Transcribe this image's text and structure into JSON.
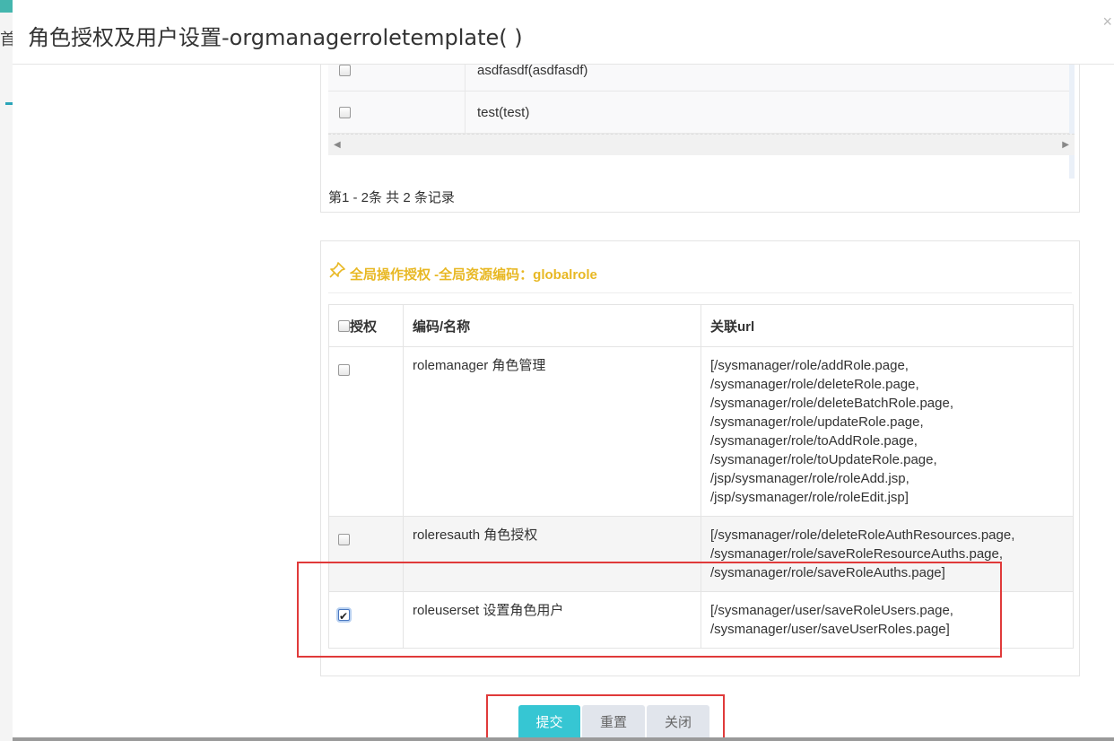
{
  "background": {
    "partial_char": "首"
  },
  "modal": {
    "title": "角色授权及用户设置-orgmanagerroletemplate( )",
    "close_label": "×"
  },
  "roles_panel": {
    "rows": [
      {
        "label": "asdfasdf(asdfasdf)",
        "checked": false
      },
      {
        "label": "test(test)",
        "checked": false
      }
    ],
    "pager_text": "第1 - 2条 共 2 条记录"
  },
  "auth_panel": {
    "icon": "pin-icon",
    "title": "全局操作授权 -全局资源编码：globalrole",
    "columns": {
      "auth": "授权",
      "code": "编码/名称",
      "url": "关联url"
    },
    "rows": [
      {
        "checked": false,
        "code_name": "rolemanager 角色管理",
        "urls": [
          "[/sysmanager/role/addRole.page,",
          "/sysmanager/role/deleteRole.page,",
          "/sysmanager/role/deleteBatchRole.page,",
          "/sysmanager/role/updateRole.page,",
          "/sysmanager/role/toAddRole.page,",
          "/sysmanager/role/toUpdateRole.page,",
          "/jsp/sysmanager/role/roleAdd.jsp,",
          "/jsp/sysmanager/role/roleEdit.jsp]"
        ]
      },
      {
        "checked": false,
        "code_name": "roleresauth 角色授权",
        "urls": [
          "[/sysmanager/role/deleteRoleAuthResources.page,",
          "/sysmanager/role/saveRoleResourceAuths.page,",
          "/sysmanager/role/saveRoleAuths.page]"
        ]
      },
      {
        "checked": true,
        "code_name": "roleuserset 设置角色用户",
        "urls": [
          "[/sysmanager/user/saveRoleUsers.page,",
          "/sysmanager/user/saveUserRoles.page]"
        ]
      }
    ]
  },
  "buttons": {
    "submit": "提交",
    "reset": "重置",
    "close": "关闭"
  },
  "colors": {
    "accent": "#36c6d3",
    "title_yellow": "#e8b824",
    "highlight_red": "#e03a3a"
  }
}
